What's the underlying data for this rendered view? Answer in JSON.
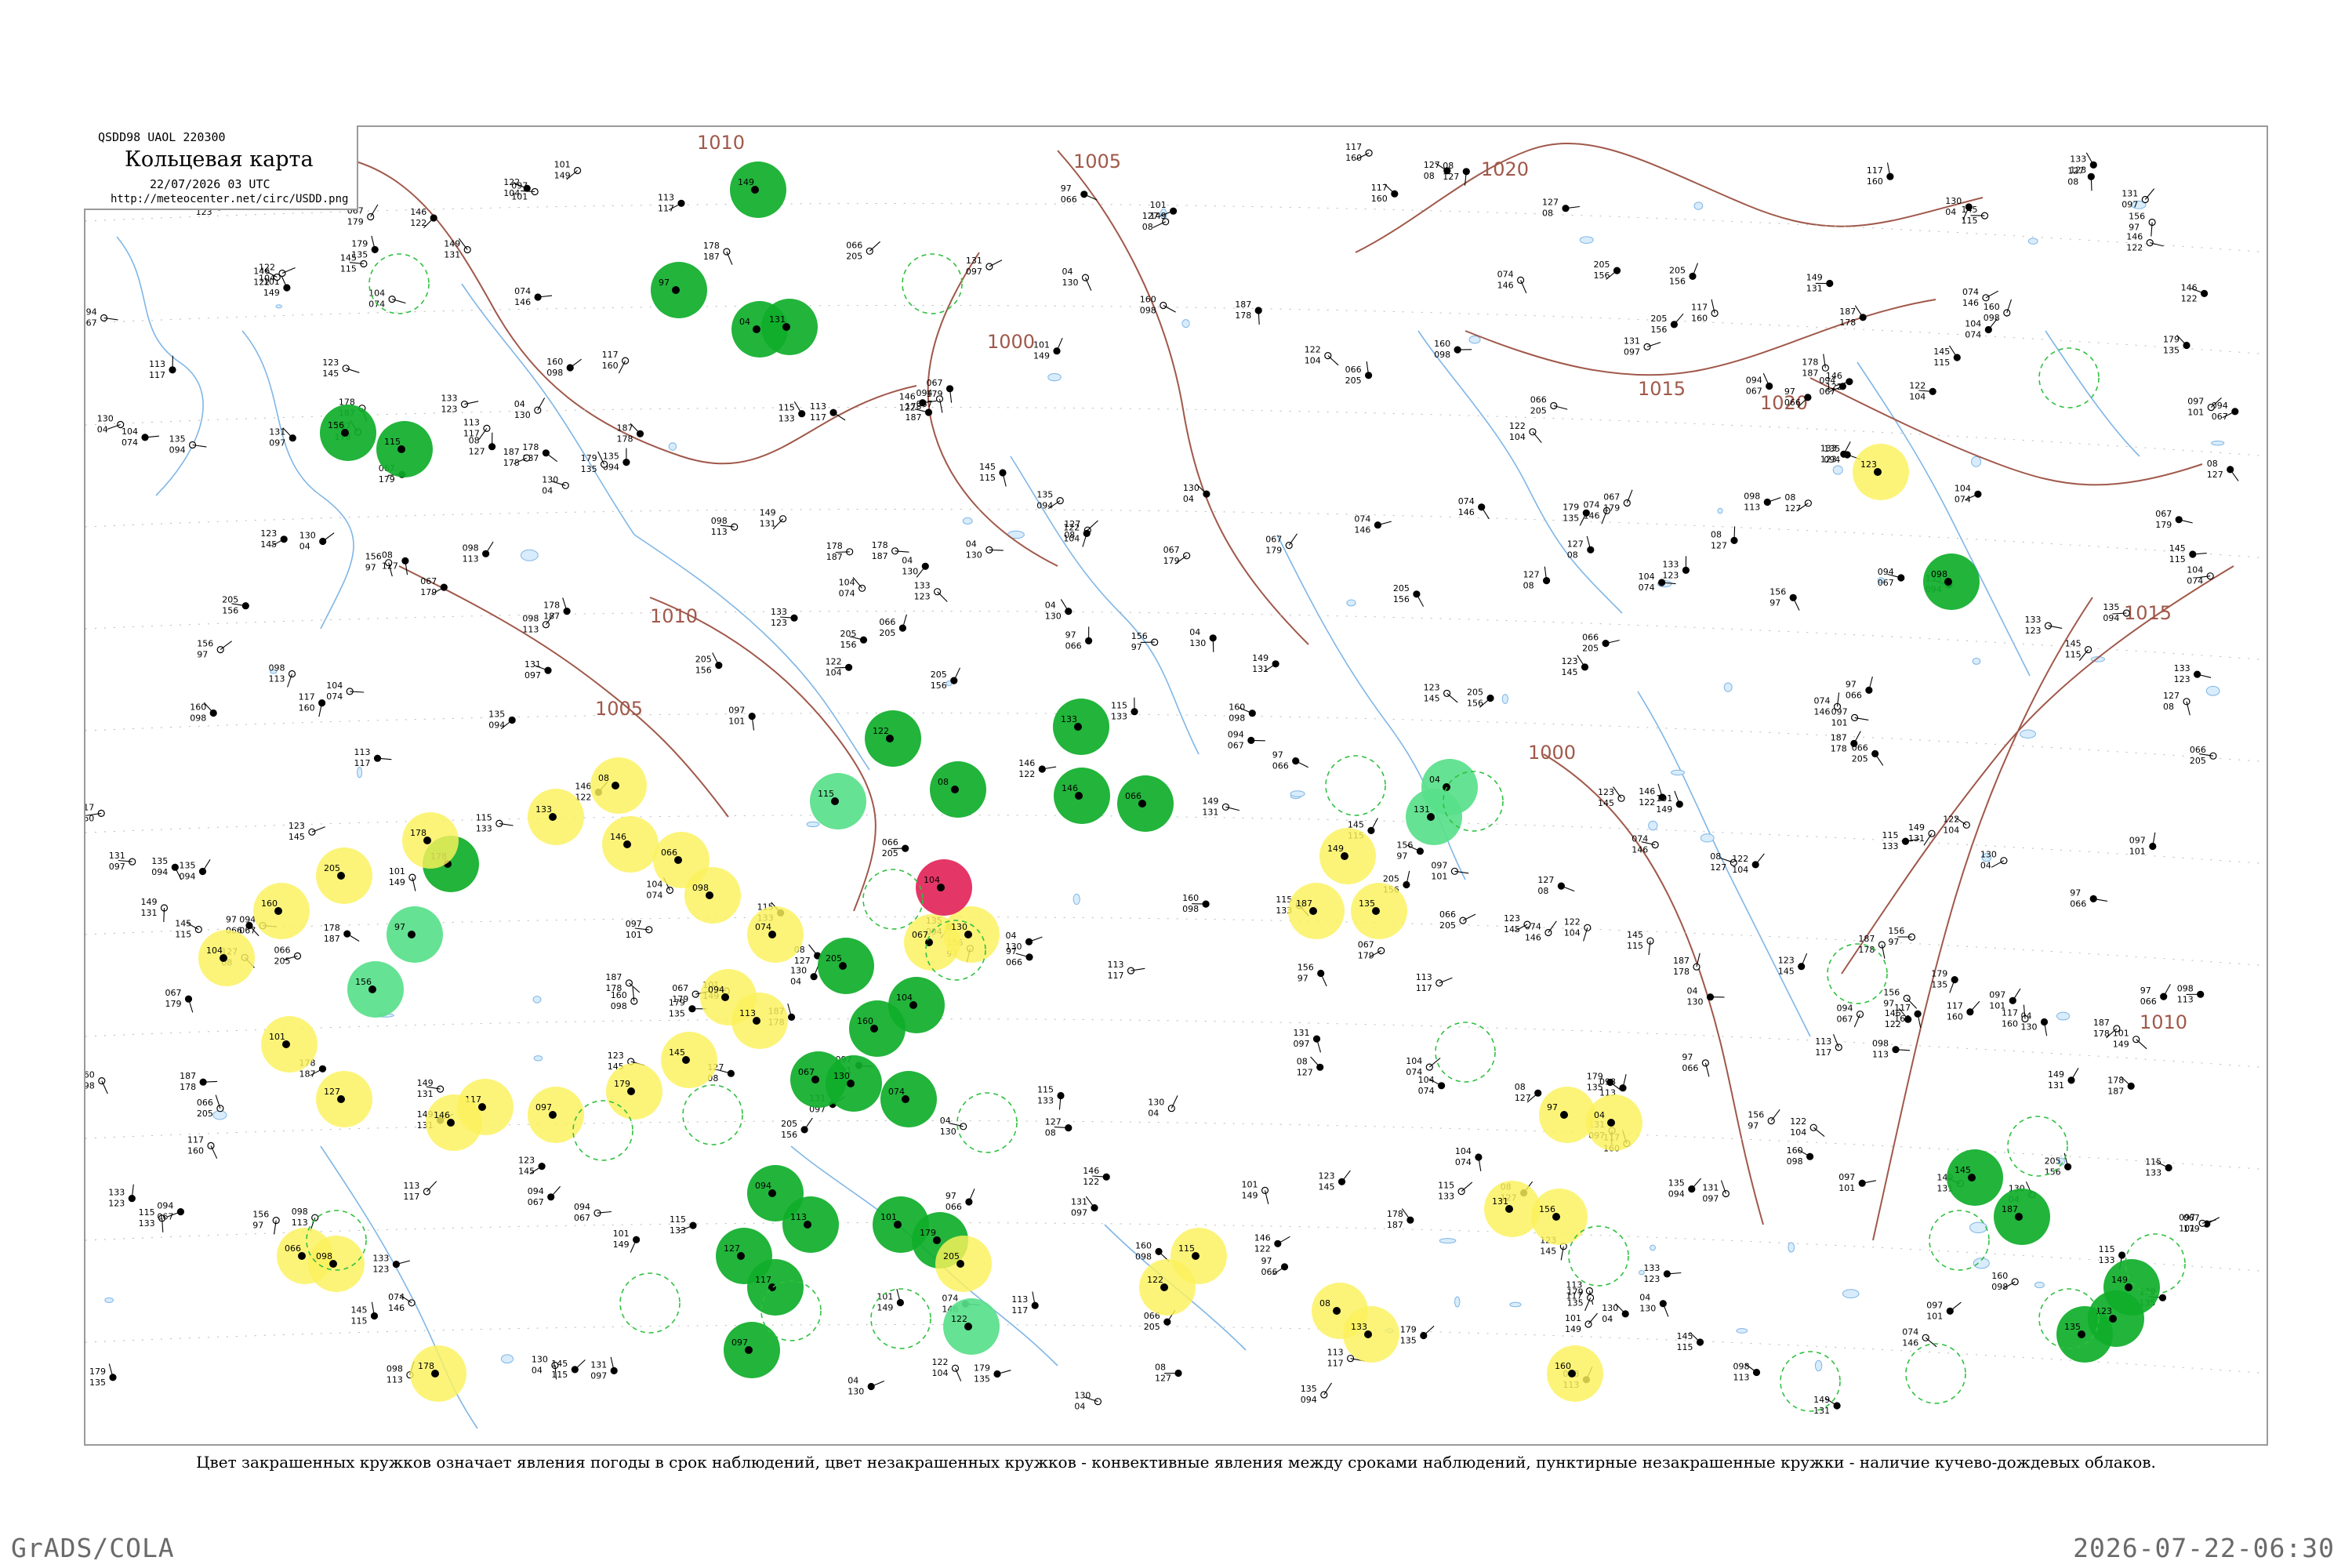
{
  "header": {
    "code": "QSDD98  UAOL  220300",
    "title": "Кольцевая карта",
    "datetime": "22/07/2026 03 UTC",
    "url": "http://meteocenter.net/circ/USDD.png"
  },
  "caption": "Цвет закрашенных кружков означает явления погоды в срок наблюдений, цвет незакрашенных кружков - конвективные явления между сроками наблюдений, пунктирные незакрашенные кружки - наличие кучево-дождевых облаков.",
  "footer": {
    "left": "GrADS/COLA",
    "right": "2026-07-22-06:30"
  },
  "colors": {
    "map_border": "#9a9a9a",
    "isobar": "#a0584a",
    "rivers": "#7fb6e6",
    "fill_rain_heavy": "#0fae2a",
    "fill_rain_light": "#58e08a",
    "fill_fog_haze": "#fbf25c",
    "fill_thunder": "#e2265a",
    "ring_dashed": "#30c040"
  },
  "isobars": [
    {
      "label": "1010"
    },
    {
      "label": "1005"
    },
    {
      "label": "1020"
    },
    {
      "label": "1015"
    },
    {
      "label": "1000"
    },
    {
      "label": "1010"
    },
    {
      "label": "1020"
    },
    {
      "label": "1015"
    },
    {
      "label": "1000"
    },
    {
      "label": "1010"
    },
    {
      "label": "1005"
    }
  ],
  "station_numbers": [
    "149",
    "97",
    "04",
    "131",
    "156",
    "115",
    "122",
    "08",
    "133",
    "146",
    "066",
    "098",
    "178",
    "205",
    "160",
    "104",
    "067",
    "130",
    "074",
    "094",
    "113",
    "101",
    "127",
    "117",
    "097",
    "179",
    "145",
    "187",
    "135",
    "123"
  ],
  "legend_markers": [
    {
      "type": "fill_rain_heavy",
      "name": "rain"
    },
    {
      "type": "fill_rain_light",
      "name": "drizzle"
    },
    {
      "type": "fill_fog_haze",
      "name": "haze"
    },
    {
      "type": "fill_thunder",
      "name": "thunderstorm"
    },
    {
      "type": "ring_dashed",
      "name": "cumulonimbus"
    }
  ]
}
